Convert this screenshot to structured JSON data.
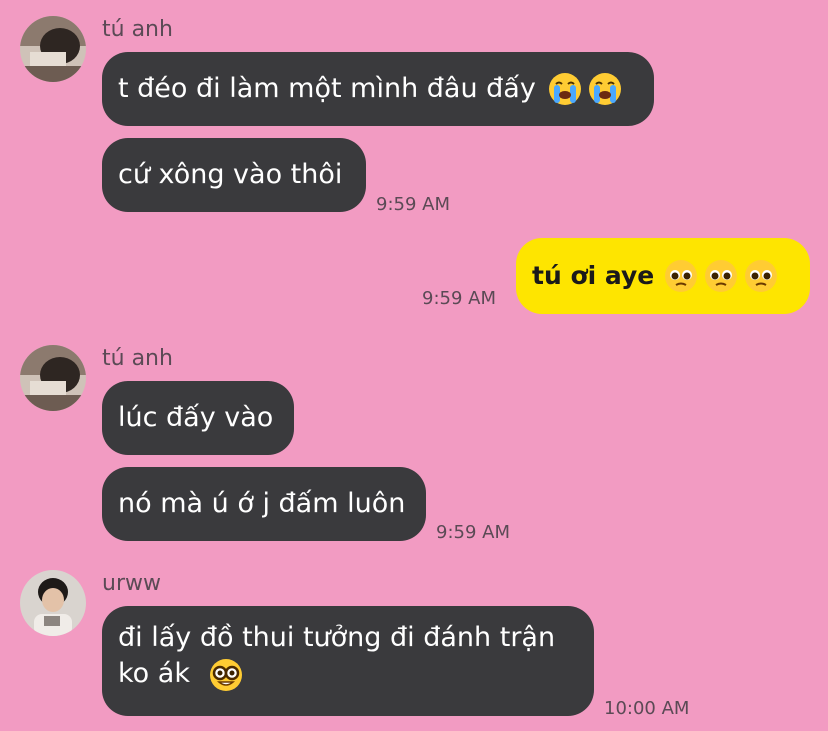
{
  "messages": [
    {
      "sender": "tú anh",
      "text_1": "t đéo đi làm một mình đâu đấy",
      "emoji_1": "loudly-crying-face-emoji x2",
      "text_2": "cứ xông vào thôi",
      "time": "9:59 AM"
    },
    {
      "mine": true,
      "text": "tú ơi aye",
      "emoji": "pleading-face-emoji x3",
      "time": "9:59 AM"
    },
    {
      "sender": "tú anh",
      "text_1": "lúc đấy vào",
      "text_2": "nó mà ú ớ j đấm luôn",
      "time": "9:59 AM"
    },
    {
      "sender": "urww",
      "text_line1": "đi lấy đồ thui tưởng đi đánh trận",
      "text_line2": "ko ák",
      "emoji": "nerd-face-emoji",
      "time": "10:00 AM"
    }
  ],
  "colors": {
    "background": "#f29bc2",
    "incoming_bubble": "#3a3a3d",
    "outgoing_bubble": "#fee500"
  }
}
